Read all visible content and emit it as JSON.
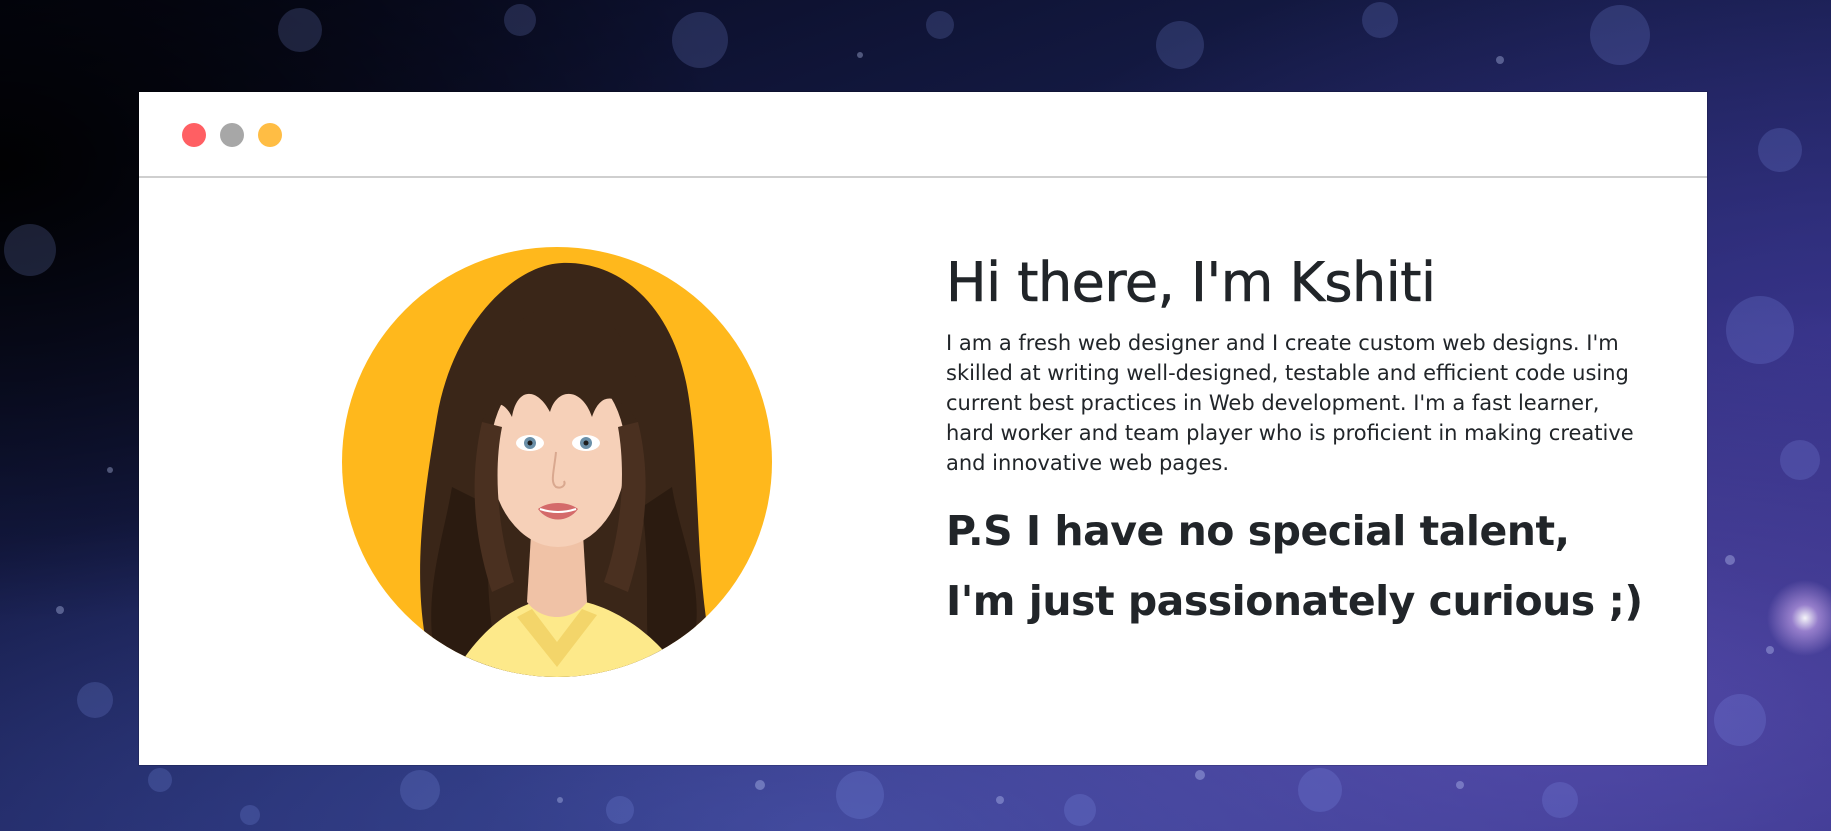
{
  "window": {
    "controls": [
      "close-dot",
      "minimize-dot",
      "maximize-dot"
    ]
  },
  "profile": {
    "heading": "Hi there, I'm Kshiti",
    "bio": "I am a fresh web designer and I create custom web designs. I'm skilled at writing well-designed, testable and efficient code using current best practices in Web development. I'm a fast learner, hard worker and team player who is proficient in making creative and innovative web pages.",
    "ps": "P.S I have no special talent, I'm just passionately curious ;)"
  },
  "colors": {
    "close_dot": "#ff5f63",
    "minimize_dot": "#a7a7a7",
    "maximize_dot": "#ffbd44",
    "avatar_background": "#ffb81c",
    "text": "#212529"
  }
}
